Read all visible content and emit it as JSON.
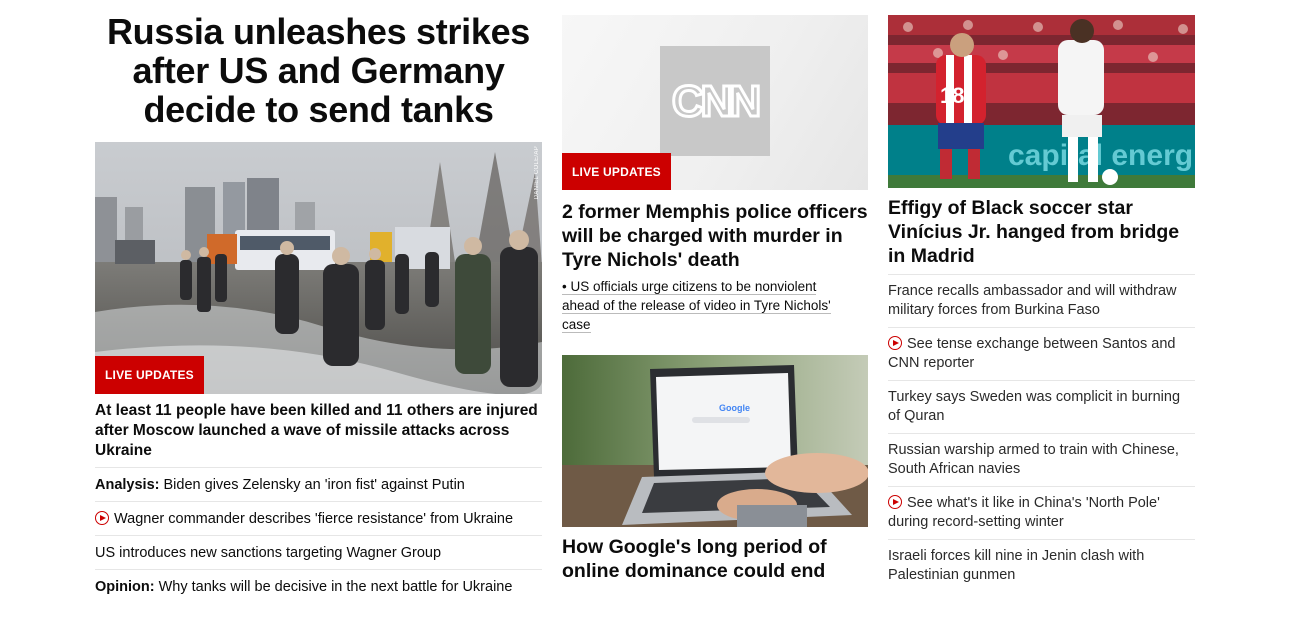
{
  "col1": {
    "headline": "Russia unleashes strikes after US and Germany decide to send tanks",
    "photo_credit": "DANIEL COLE/AP",
    "live_badge": "LIVE UPDATES",
    "lead": "At least 11 people have been killed and 11 others are injured after Moscow launched a wave of missile attacks across Ukraine",
    "items": [
      {
        "prefix": "Analysis:",
        "text": "Biden gives Zelensky an 'iron fist' against Putin"
      },
      {
        "prefix": "",
        "text": "Wagner commander describes 'fierce resistance' from Ukraine",
        "video": true
      },
      {
        "prefix": "",
        "text": "US introduces new sanctions targeting Wagner Group"
      },
      {
        "prefix": "Opinion:",
        "text": "Why tanks will be decisive in the next battle for Ukraine"
      }
    ]
  },
  "col2": {
    "live_badge": "LIVE UPDATES",
    "logo_text": "CNN",
    "headline": "2 former Memphis police officers will be charged with murder in Tyre Nichols' death",
    "sub": "• US officials urge citizens to be nonviolent ahead of the release of video in Tyre Nichols' case",
    "google_logo": "Google",
    "headline2": "How Google's long period of online dominance could end"
  },
  "col3": {
    "jersey_number": "18",
    "board_text": "capital energ",
    "headline": "Effigy of Black soccer star Vinícius Jr. hanged from bridge in Madrid",
    "items": [
      {
        "text": "France recalls ambassador and will withdraw military forces from Burkina Faso"
      },
      {
        "text": "See tense exchange between Santos and CNN reporter",
        "video": true
      },
      {
        "text": "Turkey says Sweden was complicit in burning of Quran"
      },
      {
        "text": "Russian warship armed to train with Chinese, South African navies"
      },
      {
        "text": "See what's it like in China's 'North Pole' during record-setting winter",
        "video": true
      },
      {
        "text": "Israeli forces kill nine in Jenin clash with Palestinian gunmen"
      }
    ]
  },
  "colors": {
    "accent": "#cc0000",
    "text": "#0c0c0c",
    "divider": "#e6e6e6"
  }
}
